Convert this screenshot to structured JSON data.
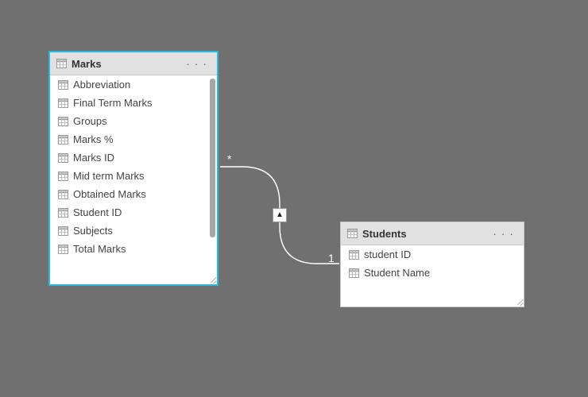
{
  "tables": {
    "marks": {
      "title": "Marks",
      "fields": [
        "Abbreviation",
        "Final Term Marks",
        "Groups",
        "Marks %",
        "Marks ID",
        "Mid term Marks",
        "Obtained Marks",
        "Student ID",
        "Subjects",
        "Total Marks"
      ]
    },
    "students": {
      "title": "Students",
      "fields": [
        "student ID",
        "Student Name"
      ]
    }
  },
  "relationship": {
    "left_cardinality": "*",
    "right_cardinality": "1",
    "filter_direction": "single"
  }
}
